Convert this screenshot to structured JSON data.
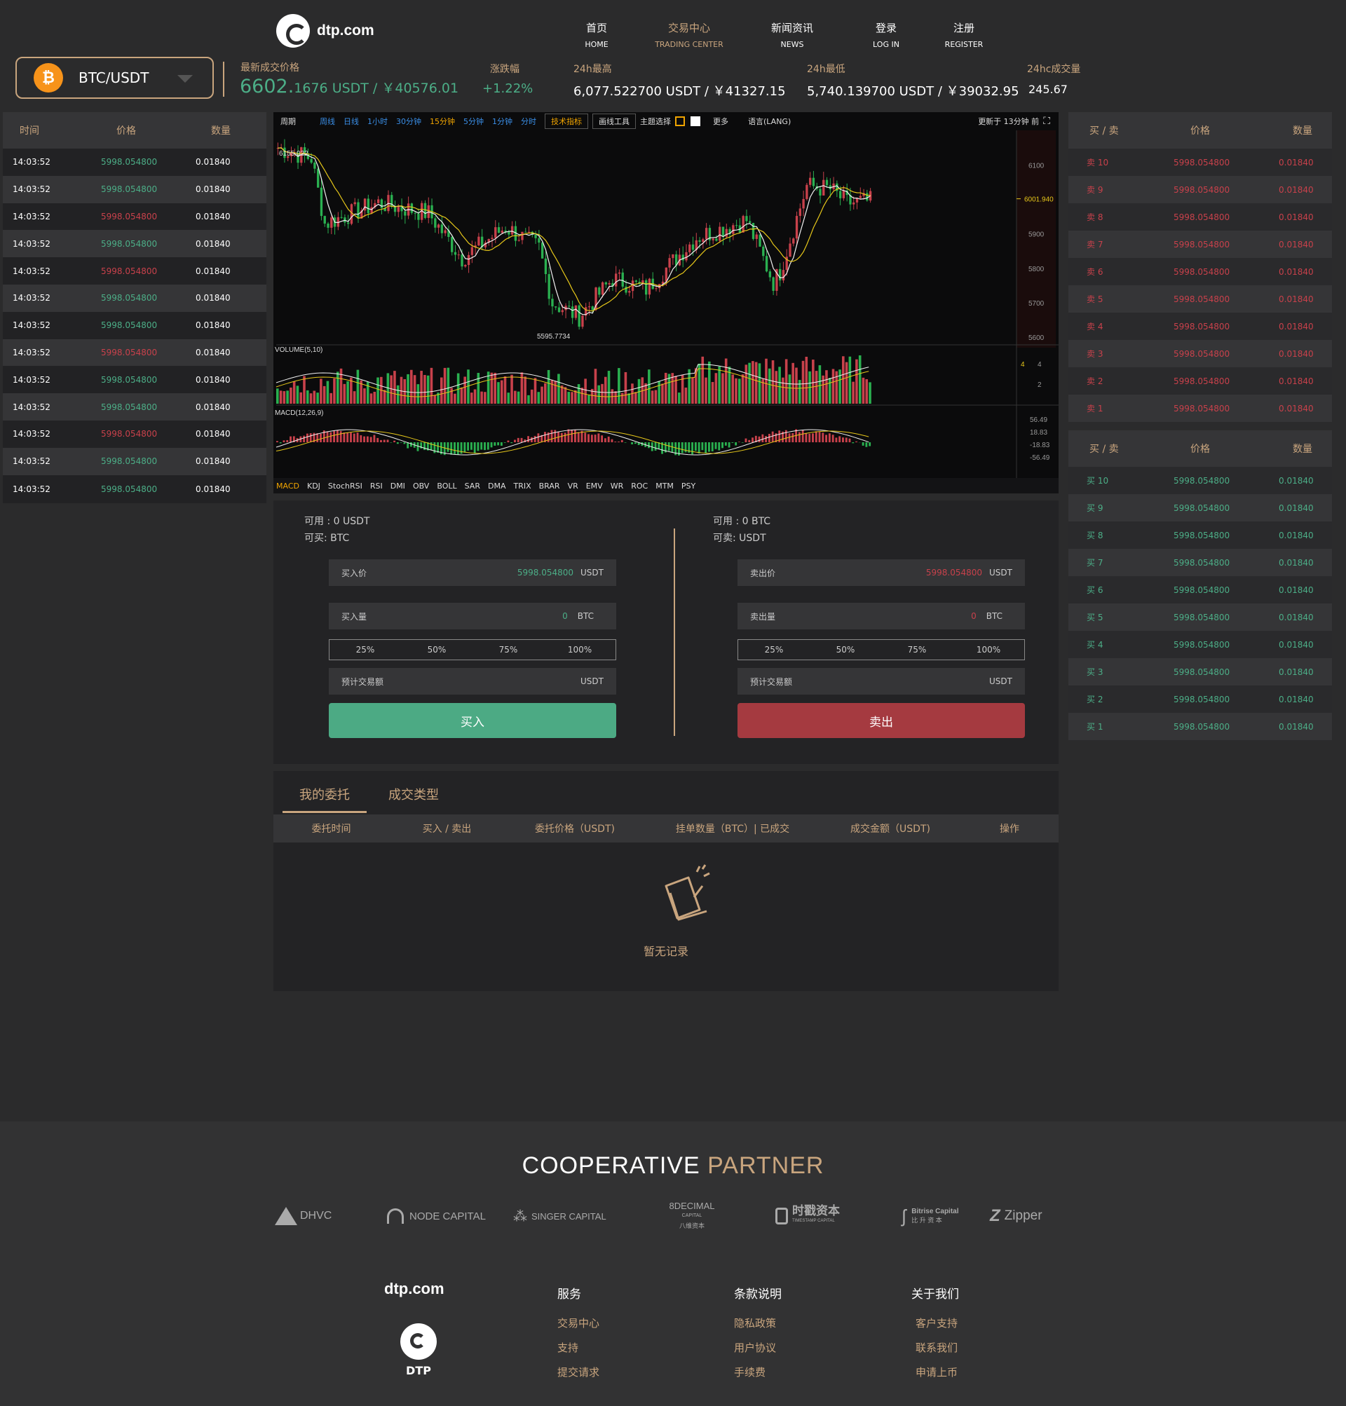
{
  "header": {
    "logo_text": "dtp.com",
    "nav": [
      {
        "zh": "首页",
        "en": "HOME"
      },
      {
        "zh": "交易中心",
        "en": "TRADING CENTER"
      },
      {
        "zh": "新闻资讯",
        "en": "NEWS"
      },
      {
        "zh": "登录",
        "en": "LOG IN"
      },
      {
        "zh": "注册",
        "en": "REGISTER"
      }
    ]
  },
  "pair": {
    "coin_symbol": "₿",
    "name": "BTC/USDT"
  },
  "stats": {
    "last_label": "最新成交价格",
    "last_big": "6602.",
    "last_small": "1676 USDT / ￥40576.01",
    "change_label": "涨跌幅",
    "change_value": "+1.22%",
    "high_label": "24h最高",
    "high_value": "6,077.522700 USDT / ￥41327.15",
    "low_label": "24h最低",
    "low_value": "5,740.139700 USDT / ￥39032.95",
    "vol_label": "24hc成交量",
    "vol_value": "245.67"
  },
  "trades": {
    "headers": [
      "时间",
      "价格",
      "数量"
    ],
    "rows": [
      {
        "time": "14:03:52",
        "price": "5998.054800",
        "qty": "0.01840",
        "side": "green"
      },
      {
        "time": "14:03:52",
        "price": "5998.054800",
        "qty": "0.01840",
        "side": "green"
      },
      {
        "time": "14:03:52",
        "price": "5998.054800",
        "qty": "0.01840",
        "side": "red"
      },
      {
        "time": "14:03:52",
        "price": "5998.054800",
        "qty": "0.01840",
        "side": "green"
      },
      {
        "time": "14:03:52",
        "price": "5998.054800",
        "qty": "0.01840",
        "side": "red"
      },
      {
        "time": "14:03:52",
        "price": "5998.054800",
        "qty": "0.01840",
        "side": "green"
      },
      {
        "time": "14:03:52",
        "price": "5998.054800",
        "qty": "0.01840",
        "side": "green"
      },
      {
        "time": "14:03:52",
        "price": "5998.054800",
        "qty": "0.01840",
        "side": "red"
      },
      {
        "time": "14:03:52",
        "price": "5998.054800",
        "qty": "0.01840",
        "side": "green"
      },
      {
        "time": "14:03:52",
        "price": "5998.054800",
        "qty": "0.01840",
        "side": "green"
      },
      {
        "time": "14:03:52",
        "price": "5998.054800",
        "qty": "0.01840",
        "side": "red"
      },
      {
        "time": "14:03:52",
        "price": "5998.054800",
        "qty": "0.01840",
        "side": "green"
      },
      {
        "time": "14:03:52",
        "price": "5998.054800",
        "qty": "0.01840",
        "side": "green"
      }
    ]
  },
  "asks": {
    "headers": [
      "买 / 卖",
      "价格",
      "数量"
    ],
    "rows": [
      {
        "label": "卖 10",
        "price": "5998.054800",
        "qty": "0.01840"
      },
      {
        "label": "卖 9",
        "price": "5998.054800",
        "qty": "0.01840"
      },
      {
        "label": "卖 8",
        "price": "5998.054800",
        "qty": "0.01840"
      },
      {
        "label": "卖 7",
        "price": "5998.054800",
        "qty": "0.01840"
      },
      {
        "label": "卖 6",
        "price": "5998.054800",
        "qty": "0.01840"
      },
      {
        "label": "卖 5",
        "price": "5998.054800",
        "qty": "0.01840"
      },
      {
        "label": "卖 4",
        "price": "5998.054800",
        "qty": "0.01840"
      },
      {
        "label": "卖 3",
        "price": "5998.054800",
        "qty": "0.01840"
      },
      {
        "label": "卖 2",
        "price": "5998.054800",
        "qty": "0.01840"
      },
      {
        "label": "卖 1",
        "price": "5998.054800",
        "qty": "0.01840"
      }
    ]
  },
  "bids": {
    "headers": [
      "买 / 卖",
      "价格",
      "数量"
    ],
    "rows": [
      {
        "label": "买 10",
        "price": "5998.054800",
        "qty": "0.01840"
      },
      {
        "label": "买 9",
        "price": "5998.054800",
        "qty": "0.01840"
      },
      {
        "label": "买 8",
        "price": "5998.054800",
        "qty": "0.01840"
      },
      {
        "label": "买 7",
        "price": "5998.054800",
        "qty": "0.01840"
      },
      {
        "label": "买 6",
        "price": "5998.054800",
        "qty": "0.01840"
      },
      {
        "label": "买 5",
        "price": "5998.054800",
        "qty": "0.01840"
      },
      {
        "label": "买 4",
        "price": "5998.054800",
        "qty": "0.01840"
      },
      {
        "label": "买 3",
        "price": "5998.054800",
        "qty": "0.01840"
      },
      {
        "label": "买 2",
        "price": "5998.054800",
        "qty": "0.01840"
      },
      {
        "label": "买 1",
        "price": "5998.054800",
        "qty": "0.01840"
      }
    ]
  },
  "chart_toolbar": {
    "period": "周期",
    "intervals": [
      "周线",
      "日线",
      "1小时",
      "30分钟",
      "15分钟",
      "5分钟",
      "1分钟",
      "分时"
    ],
    "indicators_btn": "技术指标",
    "draw_btn": "画线工具",
    "theme": "主题选择",
    "more": "更多",
    "lang": "语言(LANG)",
    "updated": "更新于 13分钟 前"
  },
  "chart_labels": {
    "price_high": "6155.022",
    "price_low": "5595.7734",
    "current_price": "6001.940",
    "price_ticks": [
      "6100",
      "5900",
      "5800",
      "5700",
      "5600"
    ],
    "volume_title": "VOLUME(5,10)",
    "volume_current": "4",
    "volume_ticks": [
      "4",
      "2"
    ],
    "macd_title": "MACD(12,26,9)",
    "macd_ticks": [
      "56.49",
      "18.83",
      "-18.83",
      "-56.49"
    ]
  },
  "indicator_tabs": [
    "MACD",
    "KDJ",
    "StochRSI",
    "RSI",
    "DMI",
    "OBV",
    "BOLL",
    "SAR",
    "DMA",
    "TRIX",
    "BRAR",
    "VR",
    "EMV",
    "WR",
    "ROC",
    "MTM",
    "PSY"
  ],
  "buy_form": {
    "avail": "可用 : 0 USDT",
    "can": "可买:  BTC",
    "price_label": "买入价",
    "price_value": "5998.054800",
    "price_unit": "USDT",
    "qty_label": "买入量",
    "qty_value": "0",
    "qty_unit": "BTC",
    "pcts": [
      "25%",
      "50%",
      "75%",
      "100%"
    ],
    "est_label": "预计交易额",
    "est_unit": "USDT",
    "button": "买入"
  },
  "sell_form": {
    "avail": "可用 : 0 BTC",
    "can": "可卖:  USDT",
    "price_label": "卖出价",
    "price_value": "5998.054800",
    "price_unit": "USDT",
    "qty_label": "卖出量",
    "qty_value": "0",
    "qty_unit": "BTC",
    "pcts": [
      "25%",
      "50%",
      "75%",
      "100%"
    ],
    "est_label": "预计交易额",
    "est_unit": "USDT",
    "button": "卖出"
  },
  "orders": {
    "tabs": [
      "我的委托",
      "成交类型"
    ],
    "columns": [
      "委托时间",
      "买入 / 卖出",
      "委托价格（USDT)",
      "挂单数量（BTC）| 已成交",
      "成交金额（USDT)",
      "操作"
    ],
    "empty": "暂无记录"
  },
  "partners": {
    "title_a": "COOPERATIVE",
    "title_b": "PARTNER",
    "logos": [
      "DHVC",
      "NODE CAPITAL",
      "SINGER CAPITAL",
      "8DECIMAL",
      "时戳资本",
      "Bitrise Capital",
      "Zipper"
    ],
    "sub_8decimal_a": "CAPITAL",
    "sub_8decimal_b": "八维资本",
    "sub_timestamp": "TIMESTAMP CAPITAL",
    "sub_bitrise": "比 升 资 本"
  },
  "footer": {
    "logo_text": "dtp.com",
    "brand": "DTP",
    "cols": [
      {
        "title": "服务",
        "items": [
          "交易中心",
          "支持",
          "提交请求"
        ]
      },
      {
        "title": "条款说明",
        "items": [
          "隐私政策",
          "用户协议",
          "手续费"
        ]
      },
      {
        "title": "关于我们",
        "items": [
          "客户支持",
          "联系我们",
          "申请上币"
        ]
      }
    ]
  },
  "colors": {
    "accent": "#c9a57e",
    "up": "#4cae87",
    "down": "#c8414b",
    "buy_btn": "#4caa84",
    "sell_btn": "#a53a40"
  }
}
